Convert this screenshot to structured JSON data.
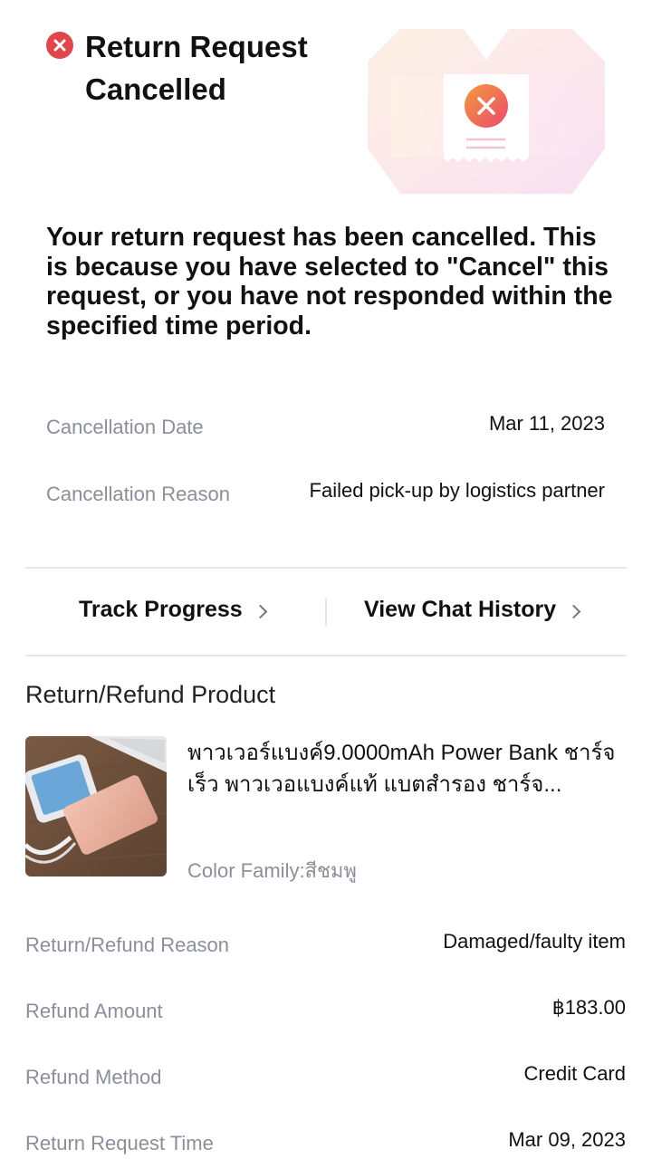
{
  "header": {
    "title": "Return Request Cancelled",
    "icon": "close-circle-icon",
    "accent_color": "#e0474c"
  },
  "message": "Your return request has been cancelled. This is because you have selected to \"Cancel\" this request, or you have not responded within the specified time period.",
  "cancellation": {
    "date_label": "Cancellation Date",
    "date_value": "Mar 11, 2023",
    "reason_label": "Cancellation Reason",
    "reason_value": "Failed pick-up by logistics partner"
  },
  "actions": {
    "track_label": "Track Progress",
    "chat_label": "View Chat History"
  },
  "product_section": {
    "title": "Return/Refund Product",
    "product_name": "พาวเวอร์แบงค์9.0000mAh Power Bank ชาร์จเร็ว พาวเวอแบงค์แท้ แบตสำรอง ชาร์จ...",
    "variant": "Color Family:สีชมพู"
  },
  "details": [
    {
      "label": "Return/Refund Reason",
      "value": "Damaged/faulty item"
    },
    {
      "label": "Refund Amount",
      "value": "฿183.00"
    },
    {
      "label": "Refund Method",
      "value": "Credit Card"
    },
    {
      "label": "Return Request Time",
      "value": "Mar 09, 2023"
    }
  ]
}
